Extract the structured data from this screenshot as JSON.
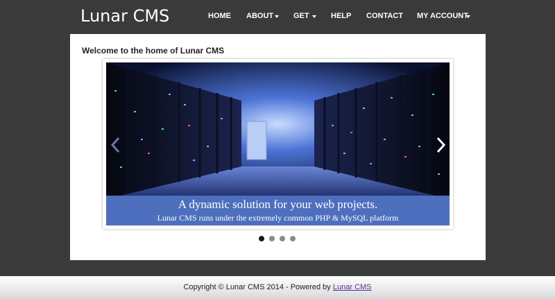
{
  "site": {
    "title": "Lunar CMS"
  },
  "nav": [
    {
      "label": "HOME",
      "dropdown": false
    },
    {
      "label": "ABOUT",
      "dropdown": true
    },
    {
      "label": "GET",
      "dropdown": true
    },
    {
      "label": "HELP",
      "dropdown": false
    },
    {
      "label": "CONTACT",
      "dropdown": false
    },
    {
      "label": "MY ACCOUNT",
      "dropdown": true
    }
  ],
  "main": {
    "welcome": "Welcome to the home of Lunar CMS",
    "slider": {
      "caption_title": "A dynamic solution for your web projects.",
      "caption_sub": "Lunar CMS runs under the extremely common PHP & MySQL platform",
      "slide_count": 4,
      "active_slide": 1
    }
  },
  "footer": {
    "text": "Copyright © Lunar CMS 2014 - Powered by",
    "link": "Lunar CMS"
  },
  "colors": {
    "background": "#3a3a3a",
    "caption_bg": "#4d6fbd",
    "footer_link": "#5b2d8e"
  }
}
